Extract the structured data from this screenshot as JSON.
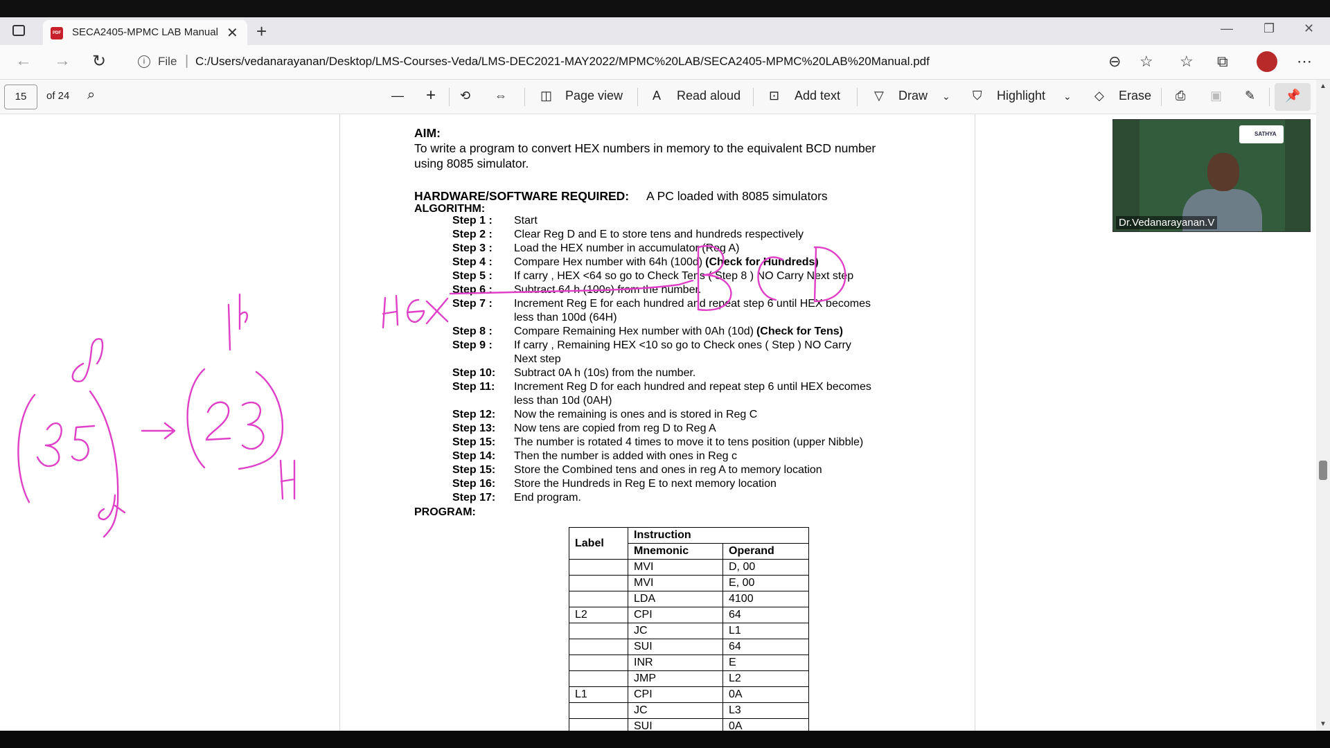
{
  "browser": {
    "tab_title": "SECA2405-MPMC LAB Manual.p",
    "new_tab_symbol": "+",
    "address_scheme": "File",
    "address_url": "C:/Users/vedanarayanan/Desktop/LMS-Courses-Veda/LMS-DEC2021-MAY2022/MPMC%20LAB/SECA2405-MPMC%20LAB%20Manual.pdf"
  },
  "pdf_toolbar": {
    "page_number": "15",
    "page_total": "of 24",
    "page_view": "Page view",
    "read_aloud": "Read aloud",
    "add_text": "Add text",
    "draw": "Draw",
    "highlight": "Highlight",
    "erase": "Erase"
  },
  "document": {
    "aim_heading": "AIM:",
    "aim_line1": "To write a program to convert HEX numbers in memory to the equivalent BCD number",
    "aim_line2": "using 8085 simulator.",
    "hw_heading": "HARDWARE/SOFTWARE REQUIRED:",
    "hw_text": "A PC loaded with 8085 simulators",
    "algorithm_heading": "ALGORITHM:",
    "steps": [
      {
        "label": "Step 1 :",
        "lines": [
          "Start"
        ]
      },
      {
        "label": "Step 2 :",
        "lines": [
          "Clear Reg D and E to store tens and hundreds respectively"
        ]
      },
      {
        "label": "Step 3 :",
        "lines": [
          "Load the HEX number in accumulator (Reg A)"
        ]
      },
      {
        "label": "Step 4 :",
        "lines": [
          "Compare Hex number with 64h (100d)"
        ],
        "bold_suffix": "(Check for Hundreds)"
      },
      {
        "label": "Step 5 :",
        "lines": [
          "If carry , HEX <64 so go to Check Tens ( Step 8 ) NO Carry Next step"
        ]
      },
      {
        "label": "Step 6 :",
        "lines": [
          "Subtract 64 h (100s) from the number."
        ]
      },
      {
        "label": "Step 7 :",
        "lines": [
          "Increment Reg E for each hundred and repeat step 6 until HEX becomes",
          "less than 100d (64H)"
        ]
      },
      {
        "label": "Step 8 :",
        "lines": [
          "Compare Remaining Hex number with 0Ah (10d)"
        ],
        "bold_suffix": "(Check for Tens)"
      },
      {
        "label": "Step 9 :",
        "lines": [
          "If carry , Remaining HEX <10 so go to Check ones ( Step ) NO Carry",
          "Next step"
        ]
      },
      {
        "label": "Step 10:",
        "lines": [
          "Subtract 0A h (10s) from the number."
        ]
      },
      {
        "label": "Step 11:",
        "lines": [
          "Increment Reg D for each hundred and repeat step 6 until HEX becomes",
          "less than 10d (0AH)"
        ]
      },
      {
        "label": "Step 12:",
        "lines": [
          "Now the remaining is ones and is stored in Reg C"
        ]
      },
      {
        "label": "Step 13:",
        "lines": [
          "Now tens are copied from reg D to Reg A"
        ]
      },
      {
        "label": "Step 15:",
        "lines": [
          "The number is rotated 4 times to move it to tens position (upper Nibble)"
        ]
      },
      {
        "label": "Step 14:",
        "lines": [
          "Then the number is added with ones in Reg c"
        ]
      },
      {
        "label": "Step 15:",
        "lines": [
          "Store the Combined tens and ones in reg A to memory location"
        ]
      },
      {
        "label": "Step 16:",
        "lines": [
          "Store the Hundreds in Reg E to next memory location"
        ]
      },
      {
        "label": "Step 17:",
        "lines": [
          "End program."
        ]
      }
    ],
    "program_heading": "PROGRAM:",
    "table": {
      "label_header": "Label",
      "instruction_header": "Instruction",
      "mnemonic_header": "Mnemonic",
      "operand_header": "Operand",
      "rows": [
        [
          "",
          "MVI",
          "D, 00"
        ],
        [
          "",
          "MVI",
          "E, 00"
        ],
        [
          "",
          "LDA",
          "4100"
        ],
        [
          "L2",
          "CPI",
          "64"
        ],
        [
          "",
          "JC",
          "L1"
        ],
        [
          "",
          "SUI",
          "64"
        ],
        [
          "",
          "INR",
          "E"
        ],
        [
          "",
          "JMP",
          "L2"
        ],
        [
          "L1",
          "CPI",
          "0A"
        ],
        [
          "",
          "JC",
          "L3"
        ],
        [
          "",
          "SUI",
          "0A"
        ]
      ]
    }
  },
  "video": {
    "presenter_name": "Dr.Vedanarayanan.V",
    "logo_text": "SATHYA"
  },
  "annotations_color": "#e040c8"
}
